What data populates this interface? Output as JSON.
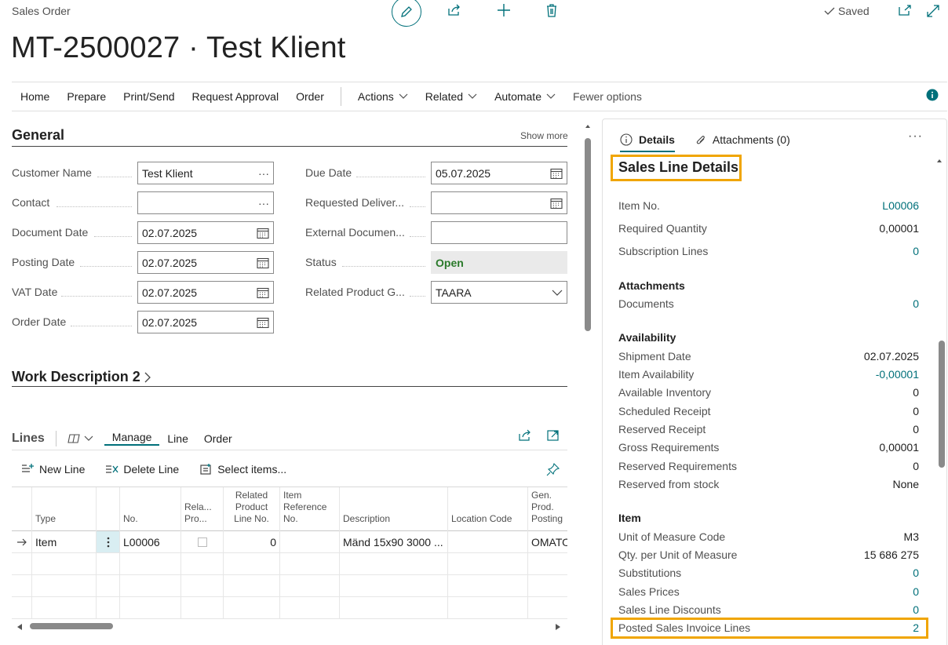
{
  "header": {
    "breadcrumb": "Sales Order",
    "title": "MT-2500027 · Test Klient",
    "saved_label": "Saved"
  },
  "actionbar": {
    "items": [
      "Home",
      "Prepare",
      "Print/Send",
      "Request Approval",
      "Order"
    ],
    "menus": [
      "Actions",
      "Related",
      "Automate"
    ],
    "fewer_options": "Fewer options"
  },
  "general": {
    "title": "General",
    "show_more": "Show more",
    "left_fields": [
      {
        "label": "Customer Name",
        "value": "Test Klient",
        "icon": "ellipsis-icon"
      },
      {
        "label": "Contact",
        "value": "",
        "icon": "ellipsis-icon"
      },
      {
        "label": "Document Date",
        "value": "02.07.2025",
        "icon": "calendar-icon"
      },
      {
        "label": "Posting Date",
        "value": "02.07.2025",
        "icon": "calendar-icon"
      },
      {
        "label": "VAT Date",
        "value": "02.07.2025",
        "icon": "calendar-icon"
      },
      {
        "label": "Order Date",
        "value": "02.07.2025",
        "icon": "calendar-icon"
      }
    ],
    "right_fields": [
      {
        "label": "Due Date",
        "value": "05.07.2025",
        "icon": "calendar-icon"
      },
      {
        "label": "Requested Deliver...",
        "value": "",
        "icon": "calendar-icon"
      },
      {
        "label": "External Documen...",
        "value": "",
        "icon": ""
      },
      {
        "label": "Status",
        "value": "Open",
        "icon": ""
      },
      {
        "label": "Related Product G...",
        "value": "TAARA",
        "icon": "chevron-down-icon"
      }
    ]
  },
  "work_description": {
    "title": "Work Description 2"
  },
  "lines": {
    "title": "Lines",
    "tabs": [
      "Manage",
      "Line",
      "Order"
    ],
    "tools": [
      "New Line",
      "Delete Line",
      "Select items..."
    ],
    "columns": [
      "Type",
      "No.",
      "Rela... Pro...",
      "Related Product Line No.",
      "Item Reference No.",
      "Description",
      "Location Code",
      "Gen. Prod. Posting"
    ],
    "rows": [
      {
        "type": "Item",
        "no": "L00006",
        "related_line_no": "0",
        "item_ref": "",
        "description": "Mänd 15x90 3000 ...",
        "location": "",
        "gen_posting": "OMATOO"
      }
    ]
  },
  "factbox": {
    "tabs": {
      "details": "Details",
      "attachments": "Attachments (0)"
    },
    "title": "Sales Line Details",
    "top_rows": [
      {
        "k": "Item No.",
        "v": "L00006",
        "link": true
      },
      {
        "k": "Required Quantity",
        "v": "0,00001",
        "link": false
      },
      {
        "k": "Subscription Lines",
        "v": "0",
        "link": true
      }
    ],
    "attachments_head": "Attachments",
    "attachments_rows": [
      {
        "k": "Documents",
        "v": "0",
        "link": true
      }
    ],
    "availability_head": "Availability",
    "availability_rows": [
      {
        "k": "Shipment Date",
        "v": "02.07.2025",
        "link": false
      },
      {
        "k": "Item Availability",
        "v": "-0,00001",
        "link": true
      },
      {
        "k": "Available Inventory",
        "v": "0",
        "link": false
      },
      {
        "k": "Scheduled Receipt",
        "v": "0",
        "link": false
      },
      {
        "k": "Reserved Receipt",
        "v": "0",
        "link": false
      },
      {
        "k": "Gross Requirements",
        "v": "0,00001",
        "link": false
      },
      {
        "k": "Reserved Requirements",
        "v": "0",
        "link": false
      },
      {
        "k": "Reserved from stock",
        "v": "None",
        "link": false
      }
    ],
    "item_head": "Item",
    "item_rows": [
      {
        "k": "Unit of Measure Code",
        "v": "M3",
        "link": false
      },
      {
        "k": "Qty. per Unit of Measure",
        "v": "15 686 275",
        "link": false
      },
      {
        "k": "Substitutions",
        "v": "0",
        "link": true
      },
      {
        "k": "Sales Prices",
        "v": "0",
        "link": true
      },
      {
        "k": "Sales Line Discounts",
        "v": "0",
        "link": true
      },
      {
        "k": "Posted Sales Invoice Lines",
        "v": "2",
        "link": true
      }
    ]
  }
}
